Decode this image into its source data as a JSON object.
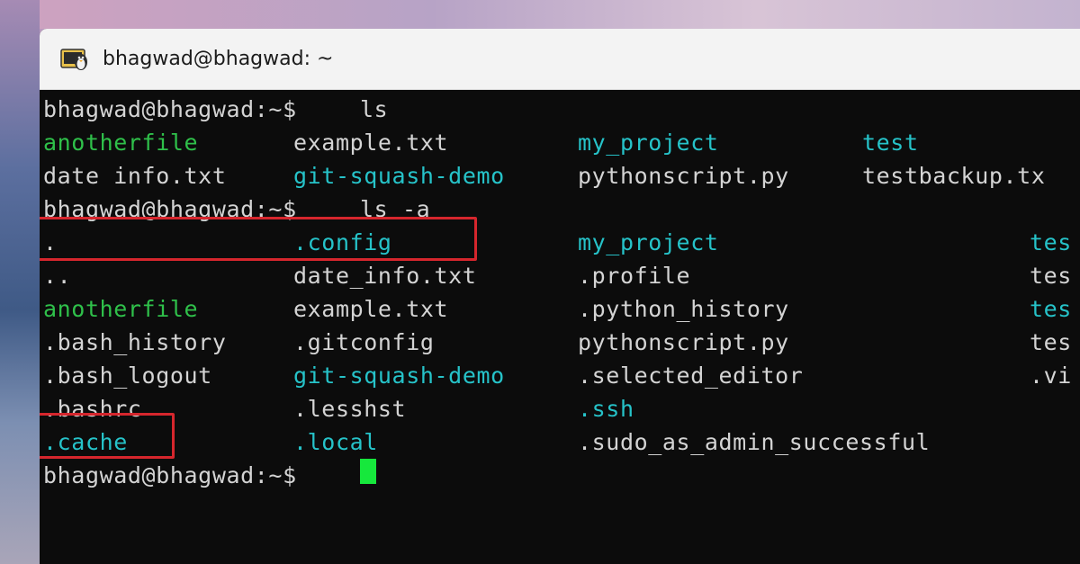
{
  "window": {
    "title": "bhagwad@bhagwad: ~"
  },
  "terminal": {
    "prompt": "bhagwad@bhagwad:~$",
    "cmd1": "ls",
    "ls_row1": [
      "anotherfile",
      "example.txt",
      "my_project",
      "test"
    ],
    "ls_row2": [
      "date info.txt",
      "git-squash-demo",
      "pythonscript.py",
      "testbackup.tx"
    ],
    "cmd2": "ls -a",
    "la_rows": [
      [
        ".",
        ".config",
        "my_project",
        "tes"
      ],
      [
        "..",
        "date_info.txt",
        ".profile",
        "tes"
      ],
      [
        "anotherfile",
        "example.txt",
        ".python_history",
        "tes"
      ],
      [
        ".bash_history",
        ".gitconfig",
        "pythonscript.py",
        "tes"
      ],
      [
        ".bash_logout",
        "git-squash-demo",
        ".selected_editor",
        ".vi"
      ],
      [
        ".bashrc",
        ".lesshst",
        ".ssh",
        ""
      ],
      [
        ".cache",
        ".local",
        ".sudo_as_admin_successful",
        ""
      ]
    ]
  },
  "colors": {
    "directory": "#26c3c9",
    "executable": "#2fc04a",
    "plain": "#d4d4d4",
    "highlight_box": "#d6262d",
    "cursor": "#16e83c"
  },
  "icons": {
    "app_icon": "penguin-terminal-icon"
  }
}
